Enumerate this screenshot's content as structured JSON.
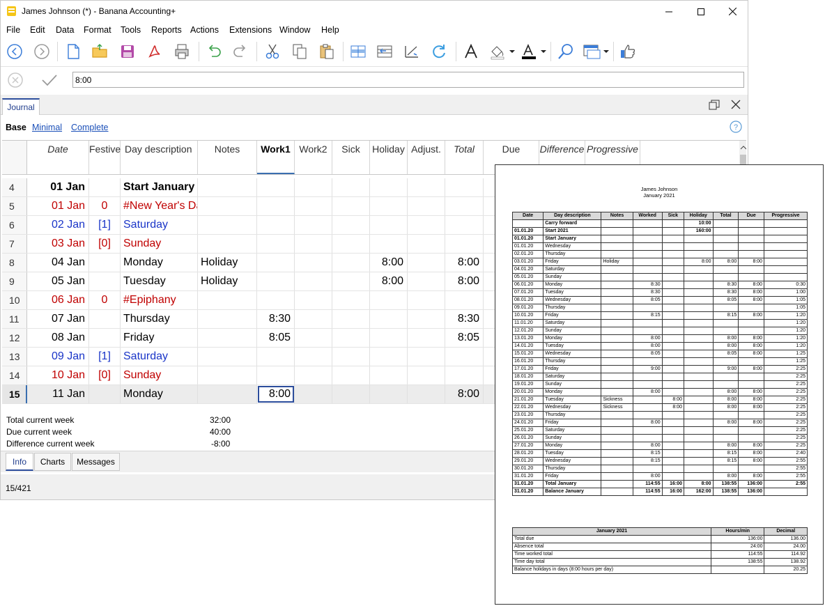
{
  "window": {
    "title": "James Johnson (*) - Banana Accounting+"
  },
  "menu": [
    "File",
    "Edit",
    "Data",
    "Format",
    "Tools",
    "Reports",
    "Actions",
    "Extensions",
    "Window",
    "Help"
  ],
  "editbar": {
    "value": "8:00"
  },
  "doc_tab": "Journal",
  "views": {
    "base": "Base",
    "minimal": "Minimal",
    "complete": "Complete"
  },
  "columns": [
    "Date",
    "Festive",
    "Day description",
    "Notes",
    "Work1",
    "Work2",
    "Sick",
    "Holiday",
    "Adjust.",
    "Total",
    "Due",
    "Difference",
    "Progressive"
  ],
  "rows": [
    {
      "n": "4",
      "date": "01 Jan",
      "festive": "",
      "desc": "Start January",
      "notes": "",
      "work1": "",
      "holiday": "",
      "total": "",
      "style": "bold"
    },
    {
      "n": "5",
      "date": "01 Jan",
      "festive": "0",
      "desc": "#New Year's Da",
      "notes": "",
      "work1": "",
      "holiday": "",
      "total": "",
      "style": "red"
    },
    {
      "n": "6",
      "date": "02 Jan",
      "festive": "[1]",
      "desc": "Saturday",
      "notes": "",
      "work1": "",
      "holiday": "",
      "total": "",
      "style": "blue"
    },
    {
      "n": "7",
      "date": "03 Jan",
      "festive": "[0]",
      "desc": "Sunday",
      "notes": "",
      "work1": "",
      "holiday": "",
      "total": "",
      "style": "red"
    },
    {
      "n": "8",
      "date": "04 Jan",
      "festive": "",
      "desc": "Monday",
      "notes": "Holiday",
      "work1": "",
      "holiday": "8:00",
      "total": "8:00",
      "style": ""
    },
    {
      "n": "9",
      "date": "05 Jan",
      "festive": "",
      "desc": "Tuesday",
      "notes": "Holiday",
      "work1": "",
      "holiday": "8:00",
      "total": "8:00",
      "style": ""
    },
    {
      "n": "10",
      "date": "06 Jan",
      "festive": "0",
      "desc": "#Epiphany",
      "notes": "",
      "work1": "",
      "holiday": "",
      "total": "",
      "style": "red"
    },
    {
      "n": "11",
      "date": "07 Jan",
      "festive": "",
      "desc": "Thursday",
      "notes": "",
      "work1": "8:30",
      "holiday": "",
      "total": "8:30",
      "style": ""
    },
    {
      "n": "12",
      "date": "08 Jan",
      "festive": "",
      "desc": "Friday",
      "notes": "",
      "work1": "8:05",
      "holiday": "",
      "total": "8:05",
      "style": ""
    },
    {
      "n": "13",
      "date": "09 Jan",
      "festive": "[1]",
      "desc": "Saturday",
      "notes": "",
      "work1": "",
      "holiday": "",
      "total": "",
      "style": "blue"
    },
    {
      "n": "14",
      "date": "10 Jan",
      "festive": "[0]",
      "desc": "Sunday",
      "notes": "",
      "work1": "",
      "holiday": "",
      "total": "",
      "style": "red"
    },
    {
      "n": "15",
      "date": "11 Jan",
      "festive": "",
      "desc": "Monday",
      "notes": "",
      "work1": "8:00",
      "holiday": "",
      "total": "8:00",
      "style": "selected"
    }
  ],
  "info": {
    "total_week_label": "Total current week",
    "total_week_value": "32:00",
    "due_week_label": "Due current week",
    "due_week_value": "40:00",
    "diff_week_label": "Difference current week",
    "diff_week_value": "-8:00"
  },
  "bottom_tabs": [
    "Info",
    "Charts",
    "Messages"
  ],
  "status": "15/421",
  "report": {
    "name": "James Johnson",
    "period": "January 2021",
    "headers": [
      "Date",
      "Day description",
      "Notes",
      "Worked",
      "Sick",
      "Holiday",
      "Total",
      "Due",
      "Progressive"
    ],
    "rows": [
      [
        "",
        "Carry forward",
        "",
        "",
        "",
        "10:00",
        "",
        "",
        "",
        1
      ],
      [
        "01.01.20",
        "Start 2021",
        "",
        "",
        "",
        "160:00",
        "",
        "",
        "",
        1
      ],
      [
        "01.01.20",
        "Start January",
        "",
        "",
        "",
        "",
        "",
        "",
        "",
        1
      ],
      [
        "01.01.20",
        "Wednesday",
        "",
        "",
        "",
        "",
        "",
        "",
        "",
        0
      ],
      [
        "02.01.20",
        "Thursday",
        "",
        "",
        "",
        "",
        "",
        "",
        "",
        0
      ],
      [
        "03.01.20",
        "Friday",
        "Holiday",
        "",
        "",
        "8:00",
        "8:00",
        "8:00",
        "",
        0
      ],
      [
        "04.01.20",
        "Saturday",
        "",
        "",
        "",
        "",
        "",
        "",
        "",
        0
      ],
      [
        "05.01.20",
        "Sunday",
        "",
        "",
        "",
        "",
        "",
        "",
        "",
        0
      ],
      [
        "06.01.20",
        "Monday",
        "",
        "8:30",
        "",
        "",
        "8:30",
        "8:00",
        "0:30",
        0
      ],
      [
        "07.01.20",
        "Tuesday",
        "",
        "8:30",
        "",
        "",
        "8:30",
        "8:00",
        "1:00",
        0
      ],
      [
        "08.01.20",
        "Wednesday",
        "",
        "8:05",
        "",
        "",
        "8:05",
        "8:00",
        "1:05",
        0
      ],
      [
        "09.01.20",
        "Thursday",
        "",
        "",
        "",
        "",
        "",
        "",
        "1:05",
        0
      ],
      [
        "10.01.20",
        "Friday",
        "",
        "8:15",
        "",
        "",
        "8:15",
        "8:00",
        "1:20",
        0
      ],
      [
        "11.01.20",
        "Saturday",
        "",
        "",
        "",
        "",
        "",
        "",
        "1:20",
        0
      ],
      [
        "12.01.20",
        "Sunday",
        "",
        "",
        "",
        "",
        "",
        "",
        "1:20",
        0
      ],
      [
        "13.01.20",
        "Monday",
        "",
        "8:00",
        "",
        "",
        "8:00",
        "8:00",
        "1:20",
        0
      ],
      [
        "14.01.20",
        "Tuesday",
        "",
        "8:00",
        "",
        "",
        "8:00",
        "8:00",
        "1:20",
        0
      ],
      [
        "15.01.20",
        "Wednesday",
        "",
        "8:05",
        "",
        "",
        "8:05",
        "8:00",
        "1:25",
        0
      ],
      [
        "16.01.20",
        "Thursday",
        "",
        "",
        "",
        "",
        "",
        "",
        "1:25",
        0
      ],
      [
        "17.01.20",
        "Friday",
        "",
        "9:00",
        "",
        "",
        "9:00",
        "8:00",
        "2:25",
        0
      ],
      [
        "18.01.20",
        "Saturday",
        "",
        "",
        "",
        "",
        "",
        "",
        "2:25",
        0
      ],
      [
        "19.01.20",
        "Sunday",
        "",
        "",
        "",
        "",
        "",
        "",
        "2:25",
        0
      ],
      [
        "20.01.20",
        "Monday",
        "",
        "8:00",
        "",
        "",
        "8:00",
        "8:00",
        "2:25",
        0
      ],
      [
        "21.01.20",
        "Tuesday",
        "Sickness",
        "",
        "8:00",
        "",
        "8:00",
        "8:00",
        "2:25",
        0
      ],
      [
        "22.01.20",
        "Wednesday",
        "Sickness",
        "",
        "8:00",
        "",
        "8:00",
        "8:00",
        "2:25",
        0
      ],
      [
        "23.01.20",
        "Thursday",
        "",
        "",
        "",
        "",
        "",
        "",
        "2:25",
        0
      ],
      [
        "24.01.20",
        "Friday",
        "",
        "8:00",
        "",
        "",
        "8:00",
        "8:00",
        "2:25",
        0
      ],
      [
        "25.01.20",
        "Saturday",
        "",
        "",
        "",
        "",
        "",
        "",
        "2:25",
        0
      ],
      [
        "26.01.20",
        "Sunday",
        "",
        "",
        "",
        "",
        "",
        "",
        "2:25",
        0
      ],
      [
        "27.01.20",
        "Monday",
        "",
        "8:00",
        "",
        "",
        "8:00",
        "8:00",
        "2:25",
        0
      ],
      [
        "28.01.20",
        "Tuesday",
        "",
        "8:15",
        "",
        "",
        "8:15",
        "8:00",
        "2:40",
        0
      ],
      [
        "29.01.20",
        "Wednesday",
        "",
        "8:15",
        "",
        "",
        "8:15",
        "8:00",
        "2:55",
        0
      ],
      [
        "30.01.20",
        "Thursday",
        "",
        "",
        "",
        "",
        "",
        "",
        "2:55",
        0
      ],
      [
        "31.01.20",
        "Friday",
        "",
        "8:00",
        "",
        "",
        "8:00",
        "8:00",
        "2:55",
        0
      ],
      [
        "31.01.20",
        "Total January",
        "",
        "114:55",
        "16:00",
        "8:00",
        "138:55",
        "136:00",
        "2:55",
        1
      ],
      [
        "31.01.20",
        "Balance January",
        "",
        "114:55",
        "16:00",
        "162:00",
        "138:55",
        "136:00",
        "",
        1
      ]
    ],
    "summary_headers": [
      "January 2021",
      "Hours/min",
      "Decimal"
    ],
    "summary": [
      [
        "Total due",
        "136:00",
        "136.00"
      ],
      [
        "Absence total",
        "24:00",
        "24.00"
      ],
      [
        "Time worked total",
        "114:55",
        "114.92"
      ],
      [
        "Time day total",
        "138:55",
        "138.92"
      ],
      [
        "Balance holidays in days (8:00 hours per day)",
        "",
        "20.25"
      ]
    ]
  }
}
